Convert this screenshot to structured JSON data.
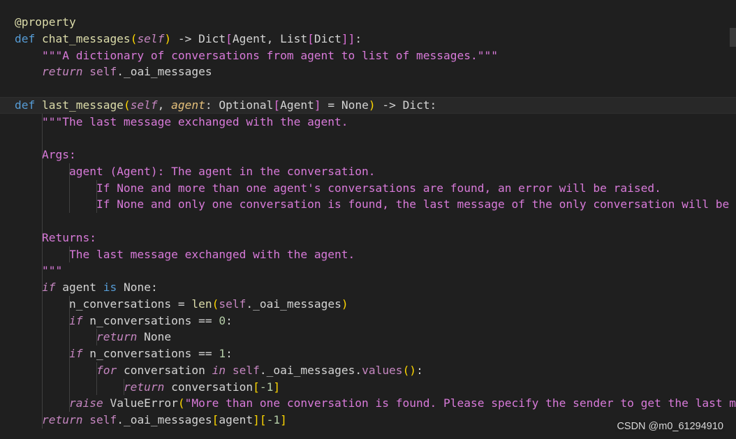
{
  "editor": {
    "lines": [
      {
        "current": false,
        "tokens": [
          {
            "t": "@property",
            "c": "dec"
          }
        ]
      },
      {
        "current": false,
        "tokens": [
          {
            "t": "def ",
            "c": "kw"
          },
          {
            "t": "chat_messages",
            "c": "fn"
          },
          {
            "t": "(",
            "c": "br1"
          },
          {
            "t": "self",
            "c": "self"
          },
          {
            "t": ")",
            "c": "br1"
          },
          {
            "t": " -> Dict",
            "c": "plain"
          },
          {
            "t": "[",
            "c": "br2"
          },
          {
            "t": "Agent, List",
            "c": "plain"
          },
          {
            "t": "[",
            "c": "br2"
          },
          {
            "t": "Dict",
            "c": "plain"
          },
          {
            "t": "]]",
            "c": "br2"
          },
          {
            "t": ":",
            "c": "plain"
          }
        ]
      },
      {
        "current": false,
        "tokens": [
          {
            "t": "    ",
            "c": "plain"
          },
          {
            "t": "\"\"\"A dictionary of conversations from agent to list of messages.\"\"\"",
            "c": "doc"
          }
        ]
      },
      {
        "current": false,
        "tokens": [
          {
            "t": "    ",
            "c": "plain"
          },
          {
            "t": "return",
            "c": "ctrl"
          },
          {
            "t": " ",
            "c": "plain"
          },
          {
            "t": "self",
            "c": "selfplain"
          },
          {
            "t": "._oai_messages",
            "c": "plain"
          }
        ]
      },
      {
        "current": false,
        "tokens": []
      },
      {
        "current": true,
        "tokens": [
          {
            "t": "def ",
            "c": "kw"
          },
          {
            "t": "last_message",
            "c": "fn"
          },
          {
            "t": "(",
            "c": "br1"
          },
          {
            "t": "self",
            "c": "self"
          },
          {
            "t": ", ",
            "c": "plain"
          },
          {
            "t": "agent",
            "c": "param"
          },
          {
            "t": ": Optional",
            "c": "plain"
          },
          {
            "t": "[",
            "c": "br2"
          },
          {
            "t": "Agent",
            "c": "plain"
          },
          {
            "t": "]",
            "c": "br2"
          },
          {
            "t": " = None",
            "c": "plain"
          },
          {
            "t": ")",
            "c": "br1"
          },
          {
            "t": " -> Dict:",
            "c": "plain"
          }
        ]
      },
      {
        "current": false,
        "tokens": [
          {
            "t": "    ",
            "c": "plain"
          },
          {
            "t": "\"\"\"The last message exchanged with the agent.",
            "c": "doc"
          }
        ]
      },
      {
        "current": false,
        "tokens": []
      },
      {
        "current": false,
        "tokens": [
          {
            "t": "    ",
            "c": "plain"
          },
          {
            "t": "Args:",
            "c": "doc"
          }
        ]
      },
      {
        "current": false,
        "tokens": [
          {
            "t": "        ",
            "c": "plain"
          },
          {
            "t": "agent (Agent): The agent in the conversation.",
            "c": "doc"
          }
        ]
      },
      {
        "current": false,
        "tokens": [
          {
            "t": "            ",
            "c": "plain"
          },
          {
            "t": "If None and more than one agent's conversations are found, an error will be raised.",
            "c": "doc"
          }
        ]
      },
      {
        "current": false,
        "tokens": [
          {
            "t": "            ",
            "c": "plain"
          },
          {
            "t": "If None and only one conversation is found, the last message of the only conversation will be re",
            "c": "doc"
          }
        ]
      },
      {
        "current": false,
        "tokens": []
      },
      {
        "current": false,
        "tokens": [
          {
            "t": "    ",
            "c": "plain"
          },
          {
            "t": "Returns:",
            "c": "doc"
          }
        ]
      },
      {
        "current": false,
        "tokens": [
          {
            "t": "        ",
            "c": "plain"
          },
          {
            "t": "The last message exchanged with the agent.",
            "c": "doc"
          }
        ]
      },
      {
        "current": false,
        "tokens": [
          {
            "t": "    ",
            "c": "plain"
          },
          {
            "t": "\"\"\"",
            "c": "doc"
          }
        ]
      },
      {
        "current": false,
        "tokens": [
          {
            "t": "    ",
            "c": "plain"
          },
          {
            "t": "if",
            "c": "ctrl"
          },
          {
            "t": " agent ",
            "c": "plain"
          },
          {
            "t": "is",
            "c": "kw"
          },
          {
            "t": " None:",
            "c": "plain"
          }
        ]
      },
      {
        "current": false,
        "tokens": [
          {
            "t": "        n_conversations = ",
            "c": "plain"
          },
          {
            "t": "len",
            "c": "fn"
          },
          {
            "t": "(",
            "c": "br1"
          },
          {
            "t": "self",
            "c": "selfplain"
          },
          {
            "t": "._oai_messages",
            "c": "plain"
          },
          {
            "t": ")",
            "c": "br1"
          }
        ]
      },
      {
        "current": false,
        "tokens": [
          {
            "t": "        ",
            "c": "plain"
          },
          {
            "t": "if",
            "c": "ctrl"
          },
          {
            "t": " n_conversations == ",
            "c": "plain"
          },
          {
            "t": "0",
            "c": "num"
          },
          {
            "t": ":",
            "c": "plain"
          }
        ]
      },
      {
        "current": false,
        "tokens": [
          {
            "t": "            ",
            "c": "plain"
          },
          {
            "t": "return",
            "c": "ctrl"
          },
          {
            "t": " None",
            "c": "plain"
          }
        ]
      },
      {
        "current": false,
        "tokens": [
          {
            "t": "        ",
            "c": "plain"
          },
          {
            "t": "if",
            "c": "ctrl"
          },
          {
            "t": " n_conversations == ",
            "c": "plain"
          },
          {
            "t": "1",
            "c": "num"
          },
          {
            "t": ":",
            "c": "plain"
          }
        ]
      },
      {
        "current": false,
        "tokens": [
          {
            "t": "            ",
            "c": "plain"
          },
          {
            "t": "for",
            "c": "ctrl"
          },
          {
            "t": " conversation ",
            "c": "plain"
          },
          {
            "t": "in",
            "c": "ctrl"
          },
          {
            "t": " ",
            "c": "plain"
          },
          {
            "t": "self",
            "c": "selfplain"
          },
          {
            "t": "._oai_messages.",
            "c": "plain"
          },
          {
            "t": "values",
            "c": "meth"
          },
          {
            "t": "()",
            "c": "br1"
          },
          {
            "t": ":",
            "c": "plain"
          }
        ]
      },
      {
        "current": false,
        "tokens": [
          {
            "t": "                ",
            "c": "plain"
          },
          {
            "t": "return",
            "c": "ctrl"
          },
          {
            "t": " conversation",
            "c": "plain"
          },
          {
            "t": "[",
            "c": "br1"
          },
          {
            "t": "-1",
            "c": "num"
          },
          {
            "t": "]",
            "c": "br1"
          }
        ]
      },
      {
        "current": false,
        "tokens": [
          {
            "t": "        ",
            "c": "plain"
          },
          {
            "t": "raise",
            "c": "ctrl"
          },
          {
            "t": " ValueError",
            "c": "plain"
          },
          {
            "t": "(",
            "c": "br1"
          },
          {
            "t": "\"More than one conversation is found. Please specify the sender to get the last mes",
            "c": "doc"
          }
        ]
      },
      {
        "current": false,
        "tokens": [
          {
            "t": "    ",
            "c": "plain"
          },
          {
            "t": "return",
            "c": "ctrl"
          },
          {
            "t": " ",
            "c": "plain"
          },
          {
            "t": "self",
            "c": "selfplain"
          },
          {
            "t": "._oai_messages",
            "c": "plain"
          },
          {
            "t": "[",
            "c": "br1"
          },
          {
            "t": "agent",
            "c": "plain"
          },
          {
            "t": "][",
            "c": "br1"
          },
          {
            "t": "-1",
            "c": "num"
          },
          {
            "t": "]",
            "c": "br1"
          }
        ]
      }
    ],
    "guides": [
      {
        "fromLine": 6,
        "toLine": 24,
        "indent": 1
      },
      {
        "fromLine": 9,
        "toLine": 11,
        "indent": 2
      },
      {
        "fromLine": 10,
        "toLine": 11,
        "indent": 3
      },
      {
        "fromLine": 14,
        "toLine": 14,
        "indent": 2
      },
      {
        "fromLine": 17,
        "toLine": 23,
        "indent": 2
      },
      {
        "fromLine": 19,
        "toLine": 19,
        "indent": 3
      },
      {
        "fromLine": 21,
        "toLine": 22,
        "indent": 3
      },
      {
        "fromLine": 22,
        "toLine": 22,
        "indent": 4
      }
    ]
  },
  "watermark": "CSDN @m0_61294910"
}
